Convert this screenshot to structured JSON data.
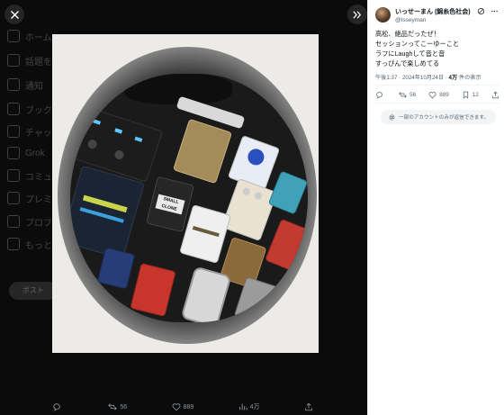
{
  "media_viewer": {
    "close_icon": "close-icon",
    "expand_icon": "chevrons-right-icon",
    "background_nav_labels": [
      "ホーム",
      "話題を検索",
      "通知",
      "ブックマーク",
      "チャット",
      "Grok",
      "コミュニティ",
      "プレミアム",
      "プロフィール",
      "もっと見る"
    ],
    "background_post_button": "ポスト",
    "actions": {
      "reply_count": "",
      "repost_count": "56",
      "like_count": "889",
      "view_count": "4万"
    }
  },
  "tweet": {
    "author_name": "いっせーまん (錦糸色社会)",
    "author_handle": "@Isseyman",
    "text_lines": [
      "高松、絶品だったぜ！",
      "セッションってこーゆーこと",
      "ラフにLaughして音と音",
      "すっぴんで楽しめてる"
    ],
    "time": "午後1:37",
    "date": "2024年10月24日",
    "views": "4万",
    "views_label": "件の表示",
    "reply_count": "",
    "repost_count": "56",
    "like_count": "889",
    "bookmark_count": "12",
    "restricted_notice": "一部のアカウントのみが返信できます。"
  },
  "colors": {
    "accent": "#1d9bf0",
    "text_primary": "#0f1419",
    "text_secondary": "#536471",
    "media_bg": "#0b0b0b"
  }
}
